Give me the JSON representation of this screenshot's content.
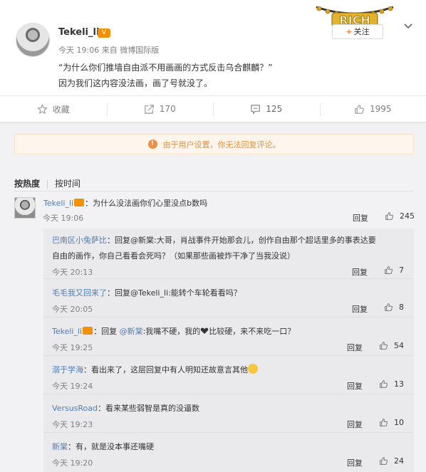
{
  "post": {
    "username": "Tekeli_li",
    "meta": "今天 19:06 来自 微博国际版",
    "text_line1": "“为什么你们推墙自由派不用画画的方式反击乌合麒麟？”",
    "text_line2": "因为我们这内容没法画，画了号就没了。",
    "follow_label": "关注",
    "rich_text": "RICH"
  },
  "actions": [
    {
      "label": "收藏",
      "icon": "star-icon"
    },
    {
      "label": "170",
      "icon": "share-icon"
    },
    {
      "label": "125",
      "icon": "comment-icon"
    },
    {
      "label": "1995",
      "icon": "thumbs-up-icon"
    }
  ],
  "notice": "由于用户设置，你无法回复评论。",
  "sort": {
    "hot": "按热度",
    "time": "按时间"
  },
  "main_comment": {
    "author": "Tekeli_li",
    "text": "：为什么没法画你们心里没点b数吗",
    "time": "今天 19:06",
    "reply": "回复",
    "likes": "245"
  },
  "replies": [
    {
      "author": "巴南区小兔萨比",
      "text": "：回复@新棠:大哥，肖战事件开始那会儿，创作自由那个超话里多的事表达要",
      "text2": "自由的画作，你自己看看会死吗？（如果那些画被炸干净了当我没说）",
      "time": "今天 20:13",
      "reply": "回复",
      "likes": "7"
    },
    {
      "author": "毛毛我又回来了",
      "text": "：回复@Tekeli_li:能转个车轮看看吗？",
      "time": "今天 20:05",
      "reply": "回复",
      "likes": "8"
    },
    {
      "author": "Tekeli_li",
      "text_pre": "：回复 ",
      "mention": "@新棠",
      "text": ":我嘴不硬，我的",
      "text_after": "比较硬，来不来吃一口？",
      "time": "今天 19:25",
      "reply": "回复",
      "likes": "54"
    },
    {
      "author": "溺于学海",
      "text": "：看出来了，这层回复中有人明知还故意言其他",
      "time": "今天 19:24",
      "reply": "回复",
      "likes": "13"
    },
    {
      "author": "VersusRoad",
      "text": "：看来某些弱智是真的没逼数",
      "time": "今天 19:23",
      "reply": "回复",
      "likes": "10"
    },
    {
      "author": "新棠",
      "text": "：有，就是没本事还嘴硬",
      "time": "今天 19:20",
      "reply": "回复",
      "likes": "24"
    }
  ],
  "colors": {
    "link": "#4e7db5",
    "accent": "#ff8140",
    "notice": "#e0903e",
    "notice_bg": "#fef6ed"
  }
}
